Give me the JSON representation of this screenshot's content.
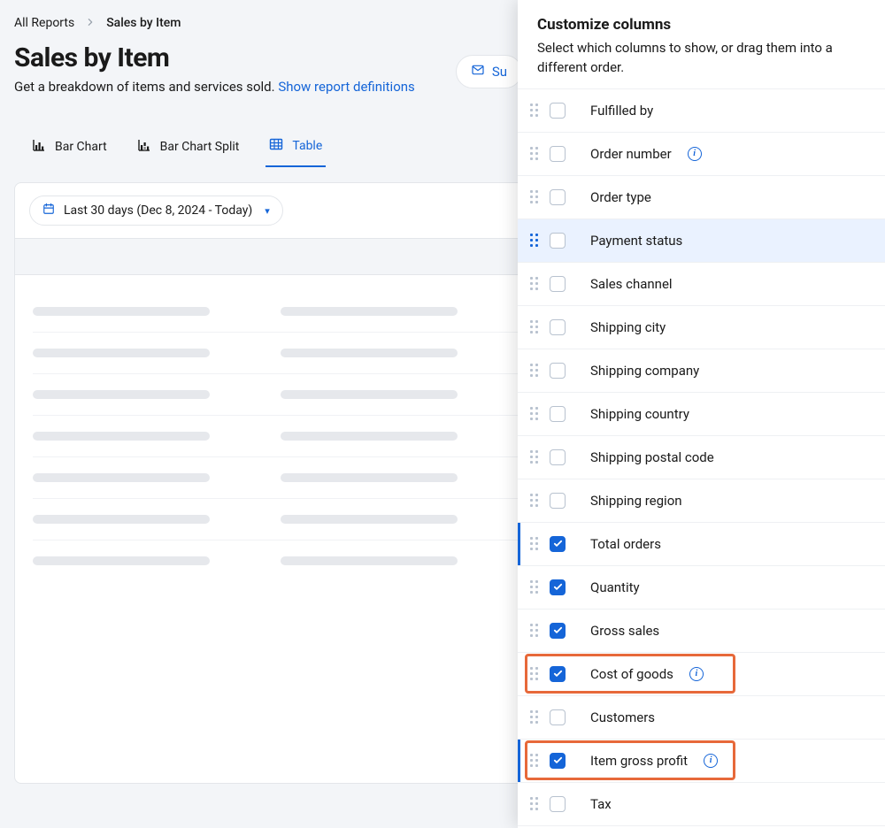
{
  "breadcrumb": {
    "root": "All Reports",
    "current": "Sales by Item"
  },
  "header": {
    "title": "Sales by Item",
    "subtitle": "Get a breakdown of items and services sold. ",
    "subtitle_link": "Show report definitions",
    "subscribe": "Su"
  },
  "tabs": {
    "bar": "Bar Chart",
    "split": "Bar Chart Split",
    "table": "Table"
  },
  "filters": {
    "date": "Last 30 days (Dec 8, 2024 - Today)"
  },
  "panel": {
    "title": "Customize columns",
    "desc": "Select which columns to show, or drag them into a different order.",
    "columns": [
      {
        "label": "Fulfilled by",
        "checked": false,
        "info": false,
        "hover": false,
        "leftbar": false,
        "highlight": false
      },
      {
        "label": "Order number",
        "checked": false,
        "info": true,
        "hover": false,
        "leftbar": false,
        "highlight": false
      },
      {
        "label": "Order type",
        "checked": false,
        "info": false,
        "hover": false,
        "leftbar": false,
        "highlight": false
      },
      {
        "label": "Payment status",
        "checked": false,
        "info": false,
        "hover": true,
        "leftbar": false,
        "highlight": false
      },
      {
        "label": "Sales channel",
        "checked": false,
        "info": false,
        "hover": false,
        "leftbar": false,
        "highlight": false
      },
      {
        "label": "Shipping city",
        "checked": false,
        "info": false,
        "hover": false,
        "leftbar": false,
        "highlight": false
      },
      {
        "label": "Shipping company",
        "checked": false,
        "info": false,
        "hover": false,
        "leftbar": false,
        "highlight": false
      },
      {
        "label": "Shipping country",
        "checked": false,
        "info": false,
        "hover": false,
        "leftbar": false,
        "highlight": false
      },
      {
        "label": "Shipping postal code",
        "checked": false,
        "info": false,
        "hover": false,
        "leftbar": false,
        "highlight": false
      },
      {
        "label": "Shipping region",
        "checked": false,
        "info": false,
        "hover": false,
        "leftbar": false,
        "highlight": false
      },
      {
        "label": "Total orders",
        "checked": true,
        "info": false,
        "hover": false,
        "leftbar": true,
        "highlight": false
      },
      {
        "label": "Quantity",
        "checked": true,
        "info": false,
        "hover": false,
        "leftbar": false,
        "highlight": false
      },
      {
        "label": "Gross sales",
        "checked": true,
        "info": false,
        "hover": false,
        "leftbar": false,
        "highlight": false
      },
      {
        "label": "Cost of goods",
        "checked": true,
        "info": true,
        "hover": false,
        "leftbar": false,
        "highlight": true
      },
      {
        "label": "Customers",
        "checked": false,
        "info": false,
        "hover": false,
        "leftbar": false,
        "highlight": false
      },
      {
        "label": "Item gross profit",
        "checked": true,
        "info": true,
        "hover": false,
        "leftbar": true,
        "highlight": true
      },
      {
        "label": "Tax",
        "checked": false,
        "info": false,
        "hover": false,
        "leftbar": false,
        "highlight": false
      }
    ]
  }
}
